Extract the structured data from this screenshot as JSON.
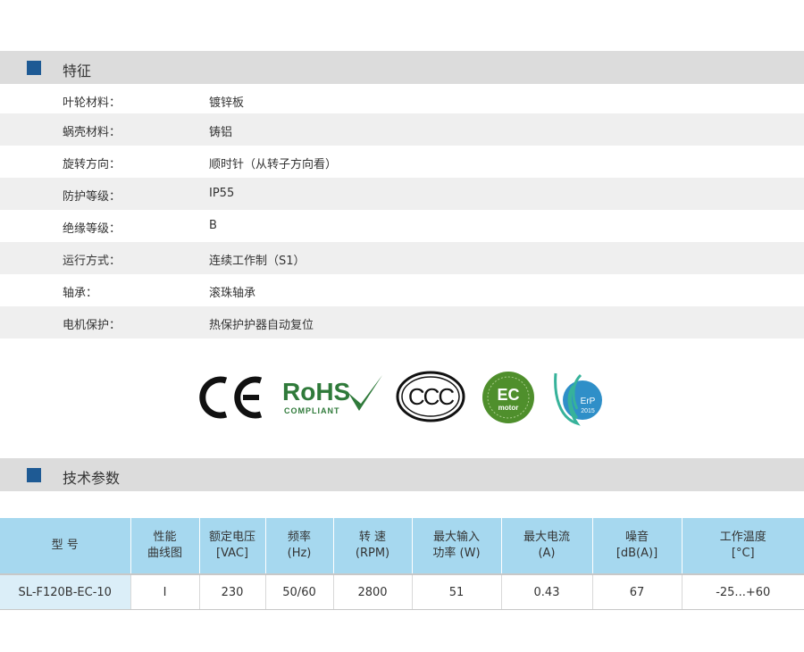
{
  "features": {
    "title": "特征",
    "rows": [
      {
        "label": "叶轮材料：",
        "value": "镀锌板"
      },
      {
        "label": "蜗壳材料：",
        "value": "铸铝"
      },
      {
        "label": "旋转方向：",
        "value": "顺时针（从转子方向看）"
      },
      {
        "label": "防护等级：",
        "value": "IP55"
      },
      {
        "label": "绝缘等级：",
        "value": "B"
      },
      {
        "label": "运行方式：",
        "value": "连续工作制（S1）"
      },
      {
        "label": "轴承：",
        "value": "滚珠轴承"
      },
      {
        "label": "电机保护：",
        "value": "热保护护器自动复位"
      }
    ]
  },
  "certifications": {
    "ce": "CE",
    "rohs": "RoHS",
    "rohs_sub": "COMPLIANT",
    "ccc": "CCC",
    "ec": "EC",
    "ec_sub": "motor",
    "erp": "ErP",
    "erp_year": "2015"
  },
  "technical": {
    "title": "技术参数",
    "headers": [
      [
        "型 号",
        ""
      ],
      [
        "性能",
        "曲线图"
      ],
      [
        "额定电压",
        "[VAC]"
      ],
      [
        "频率",
        "(Hz)"
      ],
      [
        "转 速",
        "(RPM)"
      ],
      [
        "最大输入",
        "功率 (W)"
      ],
      [
        "最大电流",
        "(A)"
      ],
      [
        "噪音",
        "[dB(A)]"
      ],
      [
        "工作温度",
        "[°C]"
      ]
    ],
    "row": [
      "SL-F120B-EC-10",
      "I",
      "230",
      "50/60",
      "2800",
      "51",
      "0.43",
      "67",
      "-25...+60"
    ]
  },
  "colors": {
    "accent": "#1e5a94",
    "section_bar": "#dcdcdc",
    "table_header": "#a6d8ef",
    "model_cell": "#dbeef8",
    "rohs_green": "#2f7a3a",
    "ec_green": "#4f8f2c"
  }
}
